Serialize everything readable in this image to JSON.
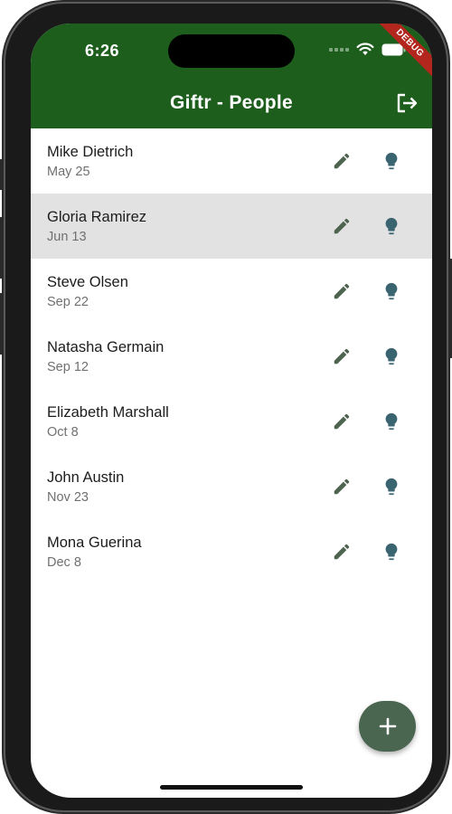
{
  "status_bar": {
    "time": "6:26",
    "debug_banner": "DEBUG"
  },
  "app_bar": {
    "title": "Giftr - People",
    "logout_icon": "logout-icon",
    "background_color": "#1e5e1d"
  },
  "people": [
    {
      "name": "Mike Dietrich",
      "date": "May 25",
      "selected": false
    },
    {
      "name": "Gloria Ramirez",
      "date": "Jun 13",
      "selected": true
    },
    {
      "name": "Steve Olsen",
      "date": "Sep 22",
      "selected": false
    },
    {
      "name": "Natasha Germain",
      "date": "Sep 12",
      "selected": false
    },
    {
      "name": "Elizabeth Marshall",
      "date": "Oct 8",
      "selected": false
    },
    {
      "name": "John Austin",
      "date": "Nov 23",
      "selected": false
    },
    {
      "name": "Mona Guerina",
      "date": "Dec 8",
      "selected": false
    }
  ],
  "row_icons": {
    "edit": "pencil-icon",
    "ideas": "lightbulb-icon",
    "edit_color": "#4e6350",
    "ideas_color": "#3a6470"
  },
  "fab": {
    "icon": "plus-icon",
    "color": "#4a6650"
  }
}
